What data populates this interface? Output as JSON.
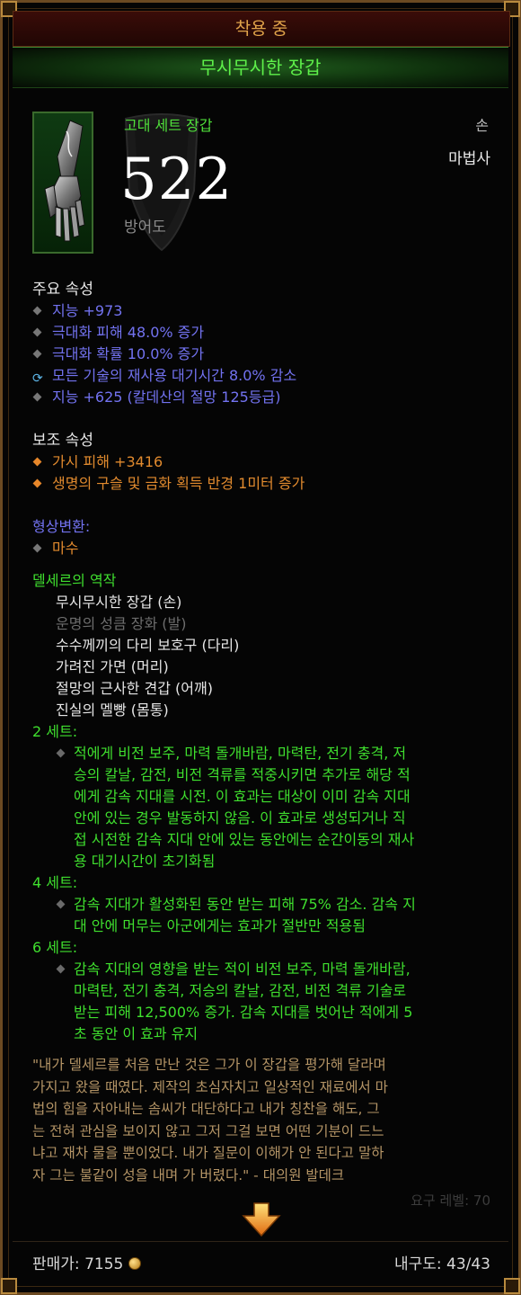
{
  "header": {
    "equipped": "착용 중",
    "item_name": "무시무시한 장갑"
  },
  "item": {
    "type": "고대 세트 장갑",
    "slot": "손",
    "class": "마법사",
    "armor_value": "522",
    "armor_label": "방어도",
    "icon": "gauntlet-icon"
  },
  "primary": {
    "title": "주요 속성",
    "stats": [
      {
        "text": "지능 +973",
        "bullet": "diamond"
      },
      {
        "text": "극대화 피해 48.0% 증가",
        "bullet": "diamond"
      },
      {
        "text": "극대화 확률 10.0% 증가",
        "bullet": "diamond"
      },
      {
        "text": "모든 기술의 재사용 대기시간 8.0% 감소",
        "bullet": "cycle-icon"
      },
      {
        "text": "지능 +625 (칼데산의 절망 125등급)",
        "bullet": "diamond"
      }
    ]
  },
  "secondary": {
    "title": "보조 속성",
    "stats": [
      {
        "text": "가시 피해 +3416"
      },
      {
        "text": "생명의 구슬 및 금화 획득 반경 1미터 증가"
      }
    ]
  },
  "transmog": {
    "title": "형상변환:",
    "value": "마수"
  },
  "set": {
    "name": "델세르의 역작",
    "pieces": [
      {
        "text": "무시무시한 장갑 (손)",
        "owned": true
      },
      {
        "text": "운명의 성큼 장화 (발)",
        "owned": false
      },
      {
        "text": "수수께끼의 다리 보호구 (다리)",
        "owned": true
      },
      {
        "text": "가려진 가면 (머리)",
        "owned": true
      },
      {
        "text": "절망의 근사한 견갑 (어깨)",
        "owned": true
      },
      {
        "text": "진실의 멜빵 (몸통)",
        "owned": true
      }
    ],
    "bonuses": [
      {
        "header": "2 세트:",
        "lines": [
          "적에게 비전 보주, 마력 돌개바람, 마력탄, 전기 충격, 저",
          "승의 칼날, 감전, 비전 격류를 적중시키면 추가로 해당 적",
          "에게 감속 지대를 시전. 이 효과는 대상이 이미 감속 지대",
          "안에 있는 경우 발동하지 않음. 이 효과로 생성되거나 직",
          "접 시전한 감속 지대 안에 있는 동안에는 순간이동의 재사",
          "용 대기시간이 초기화됨"
        ]
      },
      {
        "header": "4 세트:",
        "lines": [
          "감속 지대가 활성화된 동안 받는 피해 75% 감소. 감속 지",
          "대 안에 머무는 아군에게는 효과가 절반만 적용됨"
        ]
      },
      {
        "header": "6 세트:",
        "lines": [
          "감속 지대의 영향을 받는 적이 비전 보주, 마력 돌개바람,",
          "마력탄, 전기 충격, 저승의 칼날, 감전, 비전 격류 기술로",
          "받는 피해 12,500% 증가. 감속 지대를 벗어난 적에게 5",
          "초 동안 이 효과 유지"
        ]
      }
    ]
  },
  "flavor": {
    "lines": [
      "\"내가 델세르를 처음 만난 것은 그가 이 장갑을 평가해 달라며",
      "가지고 왔을 때였다. 제작의 초심자치고 일상적인 재료에서 마",
      "법의 힘을 자아내는 솜씨가 대단하다고 내가 칭찬을 해도, 그",
      "는 전혀 관심을 보이지 않고 그저 그걸 보면 어떤 기분이 드느",
      "냐고 재차 물을 뿐이었다. 내가 질문이 이해가 안 된다고 말하",
      "자 그는 불같이 성을 내며 가 버렸다.\" - 대의원 발데크"
    ]
  },
  "required_level": "요구 레벨: 70",
  "footer": {
    "price_label": "판매가:",
    "price": "7155",
    "durability_label": "내구도:",
    "durability": "43/43"
  },
  "colors": {
    "set_green": "#3fdf2e",
    "magic_blue": "#7272f0",
    "secondary_orange": "#e18a2e",
    "flavor_tan": "#b59566",
    "title_gold": "#e0a34a"
  }
}
